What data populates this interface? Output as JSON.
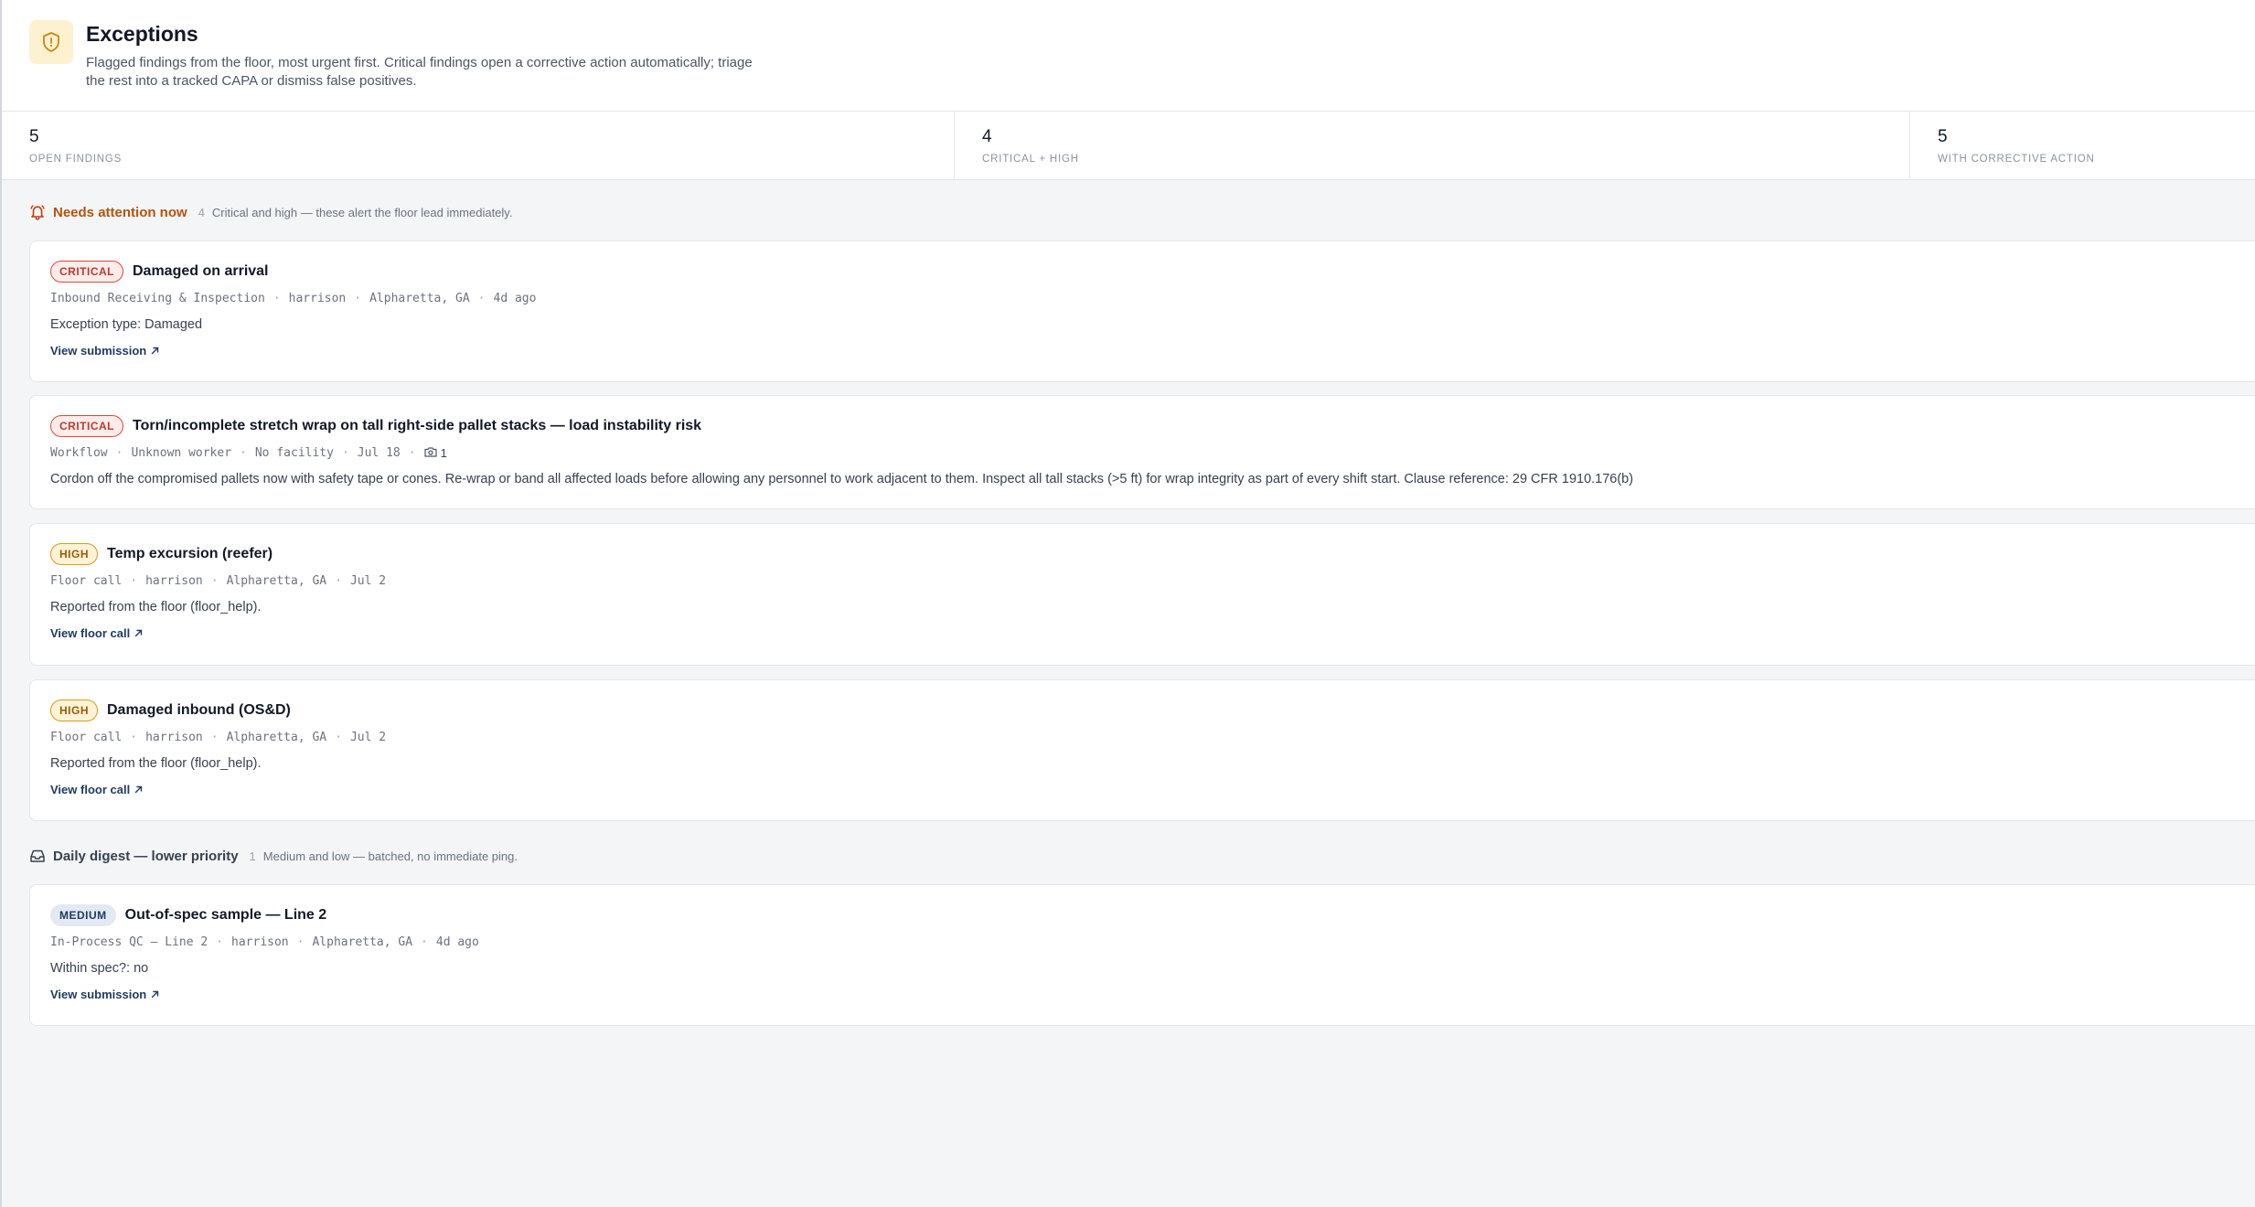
{
  "header": {
    "icon": "shield-alert-icon",
    "title": "Exceptions",
    "description": "Flagged findings from the floor, most urgent first. Critical findings open a corrective action automatically; triage the rest into a tracked CAPA or dismiss false positives."
  },
  "stats": [
    {
      "value": "5",
      "label": "Open findings"
    },
    {
      "value": "4",
      "label": "Critical + high"
    },
    {
      "value": "5",
      "label": "With corrective action"
    }
  ],
  "attention": {
    "icon": "bell-icon",
    "title": "Needs attention now",
    "count": "4",
    "note": "Critical and high — these alert the floor lead immediately.",
    "cards": [
      {
        "severity": "Critical",
        "title": "Damaged on arrival",
        "meta": [
          "Inbound Receiving & Inspection",
          "harrison",
          "Alpharetta, GA",
          "4d ago"
        ],
        "body": "Exception type: Damaged",
        "link": "View submission"
      },
      {
        "severity": "Critical",
        "title": "Torn/incomplete stretch wrap on tall right-side pallet stacks — load instability risk",
        "meta": [
          "Workflow",
          "Unknown worker",
          "No facility",
          "Jul 18"
        ],
        "photos": "1",
        "body": "Cordon off the compromised pallets now with safety tape or cones. Re-wrap or band all affected loads before allowing any personnel to work adjacent to them. Inspect all tall stacks (>5 ft) for wrap integrity as part of every shift start. Clause reference: 29 CFR 1910.176(b)"
      },
      {
        "severity": "High",
        "title": "Temp excursion (reefer)",
        "meta": [
          "Floor call",
          "harrison",
          "Alpharetta, GA",
          "Jul 2"
        ],
        "body": "Reported from the floor (floor_help).",
        "link": "View floor call"
      },
      {
        "severity": "High",
        "title": "Damaged inbound (OS&D)",
        "meta": [
          "Floor call",
          "harrison",
          "Alpharetta, GA",
          "Jul 2"
        ],
        "body": "Reported from the floor (floor_help).",
        "link": "View floor call"
      }
    ]
  },
  "digest": {
    "icon": "inbox-icon",
    "title": "Daily digest — lower priority",
    "count": "1",
    "note": "Medium and low — batched, no immediate ping.",
    "cards": [
      {
        "severity": "Medium",
        "title": "Out-of-spec sample — Line 2",
        "meta": [
          "In-Process QC — Line 2",
          "harrison",
          "Alpharetta, GA",
          "4d ago"
        ],
        "body": "Within spec?: no",
        "link": "View submission"
      }
    ]
  }
}
